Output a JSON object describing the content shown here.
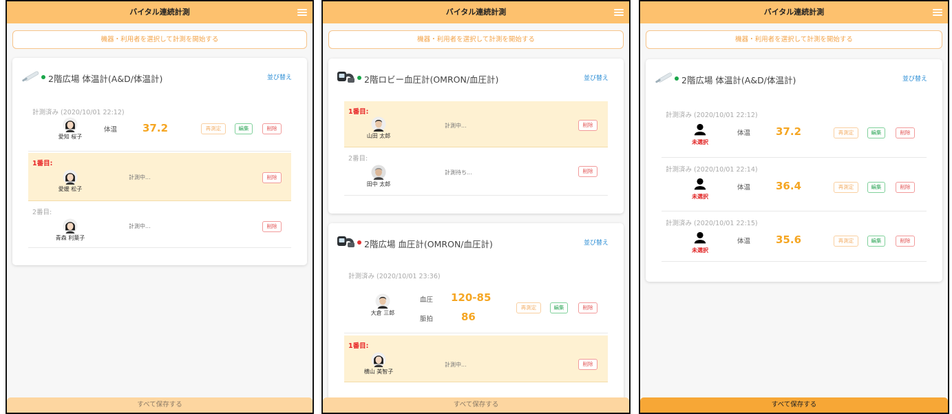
{
  "app": {
    "title": "バイタル連続計測",
    "start_label": "機器・利用者を選択して計測を開始する",
    "save_label": "すべて保存する",
    "sort_label": "並び替え",
    "buttons": {
      "remeasure": "再測定",
      "edit": "編集",
      "delete": "削除"
    }
  },
  "screens": [
    {
      "cards": [
        {
          "title": "2階広場 体温計(A&D/体温計)",
          "status": "connected",
          "device_icon": "thermometer-icon",
          "rows": [
            {
              "label": "計測済み (2020/10/01 22:12)",
              "person": "愛知 桜子",
              "avatar": "female-avatar-icon",
              "vital_label": "体温",
              "value": "37.2"
            },
            {
              "label": "1番目:",
              "person": "愛媛 松子",
              "avatar": "female-avatar-icon",
              "status_text": "計測中..."
            },
            {
              "label": "2番目:",
              "person": "青森 利葉子",
              "avatar": "female-avatar-icon",
              "status_text": "計測中..."
            }
          ]
        }
      ]
    },
    {
      "cards": [
        {
          "title": "2階ロビー血圧計(OMRON/血圧計)",
          "status": "connected",
          "device_icon": "blood-pressure-monitor-icon",
          "rows": [
            {
              "label": "1番目:",
              "person": "山田 太郎",
              "avatar": "male-avatar-icon",
              "status_text": "計測中..."
            },
            {
              "label": "2番目:",
              "person": "田中 太郎",
              "avatar": "elder-male-avatar-icon",
              "status_text": "計測待ち..."
            }
          ]
        },
        {
          "title": "2階広場 血圧計(OMRON/血圧計)",
          "status": "disconnected",
          "device_icon": "blood-pressure-monitor-icon",
          "rows": [
            {
              "label": "計測済み (2020/10/01 23:36)",
              "person": "大倉 三郎",
              "avatar": "male-avatar-icon",
              "vital_label": "血圧",
              "value": "120-85",
              "vital_label2": "脈拍",
              "value2": "86"
            },
            {
              "label": "1番目:",
              "person": "横山 美智子",
              "avatar": "female-avatar-icon",
              "status_text": "計測中..."
            }
          ]
        }
      ]
    },
    {
      "cards": [
        {
          "title": "2階広場 体温計(A&D/体温計)",
          "status": "connected",
          "device_icon": "thermometer-icon",
          "rows": [
            {
              "label": "計測済み (2020/10/01 22:12)",
              "person": "未選択",
              "avatar": "unselected-user-icon",
              "vital_label": "体温",
              "value": "37.2"
            },
            {
              "label": "計測済み (2020/10/01 22:14)",
              "person": "未選択",
              "avatar": "unselected-user-icon",
              "vital_label": "体温",
              "value": "36.4"
            },
            {
              "label": "計測済み (2020/10/01 22:15)",
              "person": "未選択",
              "avatar": "unselected-user-icon",
              "vital_label": "体温",
              "value": "35.6"
            }
          ]
        }
      ]
    }
  ],
  "colors": {
    "header": "#fdc16e",
    "accent_orange": "#f5a623",
    "save_enabled": "#f7a736",
    "save_disabled": "#fdd6a0",
    "status_connected": "#1aa64a",
    "status_disconnected": "#e33030",
    "waiting_bg": "#fef1d2"
  }
}
